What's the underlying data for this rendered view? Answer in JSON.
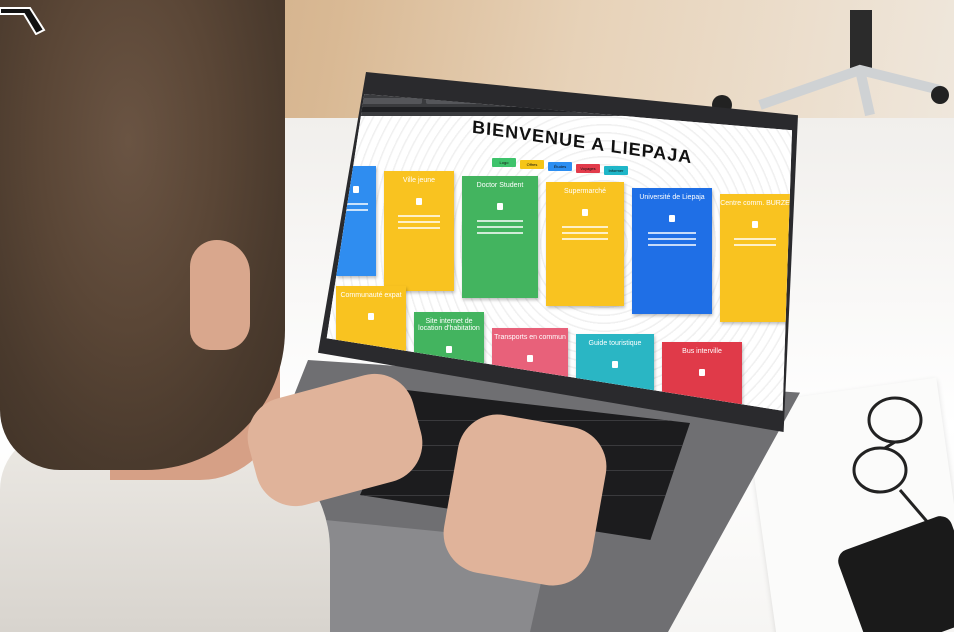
{
  "screen": {
    "title": "BIENVENUE A LIEPAJA",
    "nav_buttons": [
      {
        "label": "Logo",
        "color": "#3ec36b"
      },
      {
        "label": "Offres",
        "color": "#f5c518"
      },
      {
        "label": "Études",
        "color": "#2c8ef2"
      },
      {
        "label": "Voyages",
        "color": "#e23b4b"
      },
      {
        "label": "Informer",
        "color": "#1fb6c8"
      }
    ],
    "cards_row1": [
      {
        "title": "",
        "color": "#2f8df0"
      },
      {
        "title": "Ville jeune",
        "color": "#f9c320"
      },
      {
        "title": "Doctor Student",
        "color": "#43b45f"
      },
      {
        "title": "Supermarché",
        "color": "#f9c320"
      },
      {
        "title": "Université de Liepaja",
        "color": "#1f6fe6"
      },
      {
        "title": "Centre comm. BURZE",
        "color": "#f9c320"
      }
    ],
    "cards_row2": [
      {
        "title": "Communauté expat",
        "color": "#f9c320"
      },
      {
        "title": "Site internet de location d'habitation",
        "color": "#43b45f"
      },
      {
        "title": "Transports en commun",
        "color": "#e8617a"
      },
      {
        "title": "Guide touristique",
        "color": "#2ab6c4"
      },
      {
        "title": "Bus interville",
        "color": "#e03a49"
      }
    ]
  },
  "colors": {
    "bezel": "#2a2a2d",
    "laptop": "#6f6f72",
    "hair": "#5a4636",
    "skin": "#e0b39a"
  }
}
